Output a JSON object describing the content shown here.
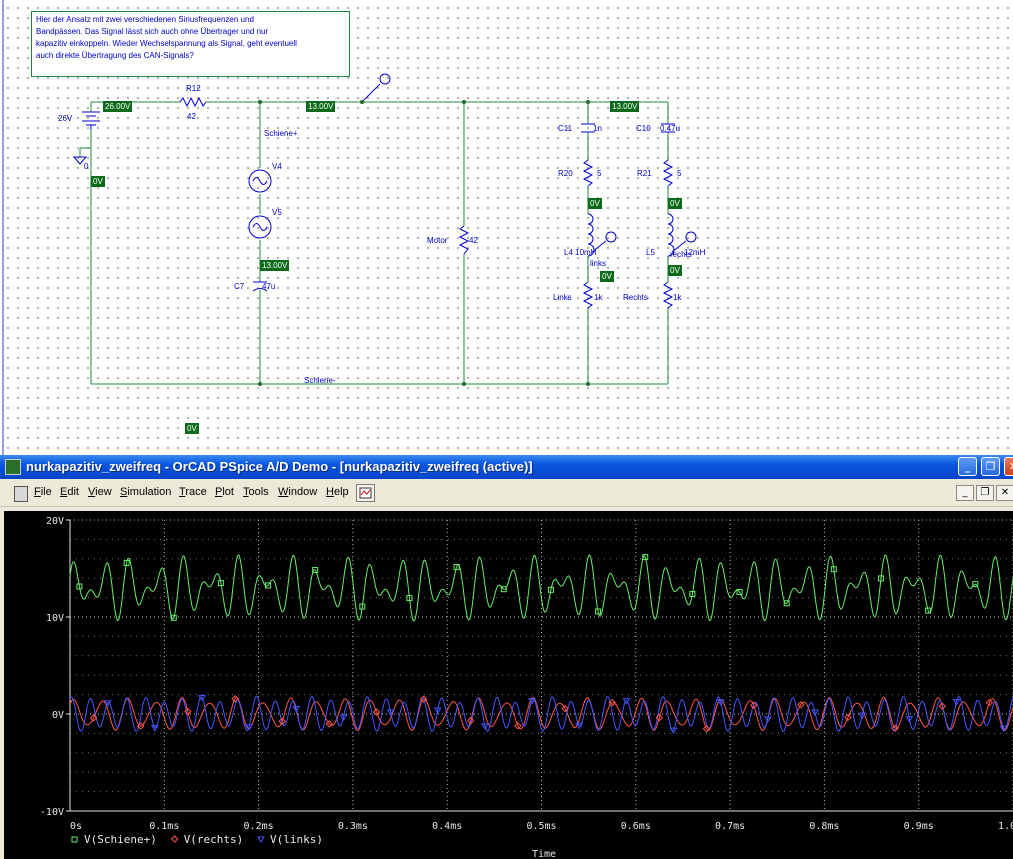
{
  "note": {
    "lines": [
      "Hier der Ansatz mit zwei verschiedenen Sinusfrequenzen und",
      "Bandpässen. Das Signal lässt sich auch ohne Übertrager und nur",
      "kapazitiv einkoppeln. Wieder Wechselspannung als Signal, geht eventuell",
      "auch direkte Übertragung des CAN-Signals?"
    ]
  },
  "schematic": {
    "labels": {
      "battery": "26V",
      "ground": "0",
      "r12": "R12",
      "r12_val": "42",
      "schiene_plus": "Schiene+",
      "v4": "V4",
      "v5": "V5",
      "c7": "C7",
      "c7_val": "47u",
      "motor": "Motor",
      "motor_val": "42",
      "schiene_minus": "Schiene-",
      "c11": "C11",
      "c11_val": "1n",
      "c10": "C10",
      "c10_val": "0.47u",
      "r20": "R20",
      "r20_val": "5",
      "r21": "R21",
      "r21_val": "5",
      "l4": "L4 10mH",
      "l5": "L5",
      "l5_val": "12mH",
      "links_probe": "links",
      "rechts_probe": "rechts",
      "links_r": "Links",
      "links_r_val": "1k",
      "rechts_r": "Rechts",
      "rechts_r_val": "1k"
    },
    "voltages": {
      "v_26": "26.00V",
      "v_0_left": "0V",
      "v_13_a": "13.00V",
      "v_13_b": "13.00V",
      "v_13_c": "13.00V",
      "v_0_c11": "0V",
      "v_0_l4": "0V",
      "v_0_c10": "0V",
      "v_0_l5": "0V",
      "v_0_bottom": "0V"
    }
  },
  "window": {
    "title": "nurkapazitiv_zweifreq - OrCAD PSpice A/D Demo  - [nurkapazitiv_zweifreq (active)]",
    "menu": [
      "File",
      "Edit",
      "View",
      "Simulation",
      "Trace",
      "Plot",
      "Tools",
      "Window",
      "Help"
    ],
    "buttons": {
      "minimize": "_",
      "restore": "❐",
      "close": "✕"
    }
  },
  "chart_data": {
    "type": "line",
    "xlabel": "Time",
    "ylabel": "",
    "xlim": [
      0,
      1.0
    ],
    "ylim": [
      -10,
      20
    ],
    "xticks": [
      "0s",
      "0.1ms",
      "0.2ms",
      "0.3ms",
      "0.4ms",
      "0.5ms",
      "0.6ms",
      "0.7ms",
      "0.8ms",
      "0.9ms",
      "1.0ms"
    ],
    "yticks": [
      "20V",
      "10V",
      "0V",
      "-10V"
    ],
    "grid": true,
    "legend_position": "bottom-left",
    "colors": {
      "schiene": "#66ee66",
      "rechts": "#ff5544",
      "links": "#4455ff"
    },
    "series": [
      {
        "name": "V(Schiene+)",
        "marker": "square",
        "color": "#66ee66",
        "offset": 13.0,
        "components": [
          {
            "amplitude": 1.8,
            "period_ms": 0.0286
          },
          {
            "amplitude": 1.6,
            "period_ms": 0.0196
          }
        ]
      },
      {
        "name": "V(rechts)",
        "marker": "diamond",
        "color": "#ff5544",
        "offset": 0.0,
        "components": [
          {
            "amplitude": 1.4,
            "period_ms": 0.0286
          },
          {
            "amplitude": 0.3,
            "period_ms": 0.0196
          }
        ]
      },
      {
        "name": "V(links)",
        "marker": "triangle",
        "color": "#4455ff",
        "offset": 0.0,
        "components": [
          {
            "amplitude": 1.5,
            "period_ms": 0.0196
          },
          {
            "amplitude": 0.3,
            "period_ms": 0.0286
          }
        ]
      }
    ]
  }
}
